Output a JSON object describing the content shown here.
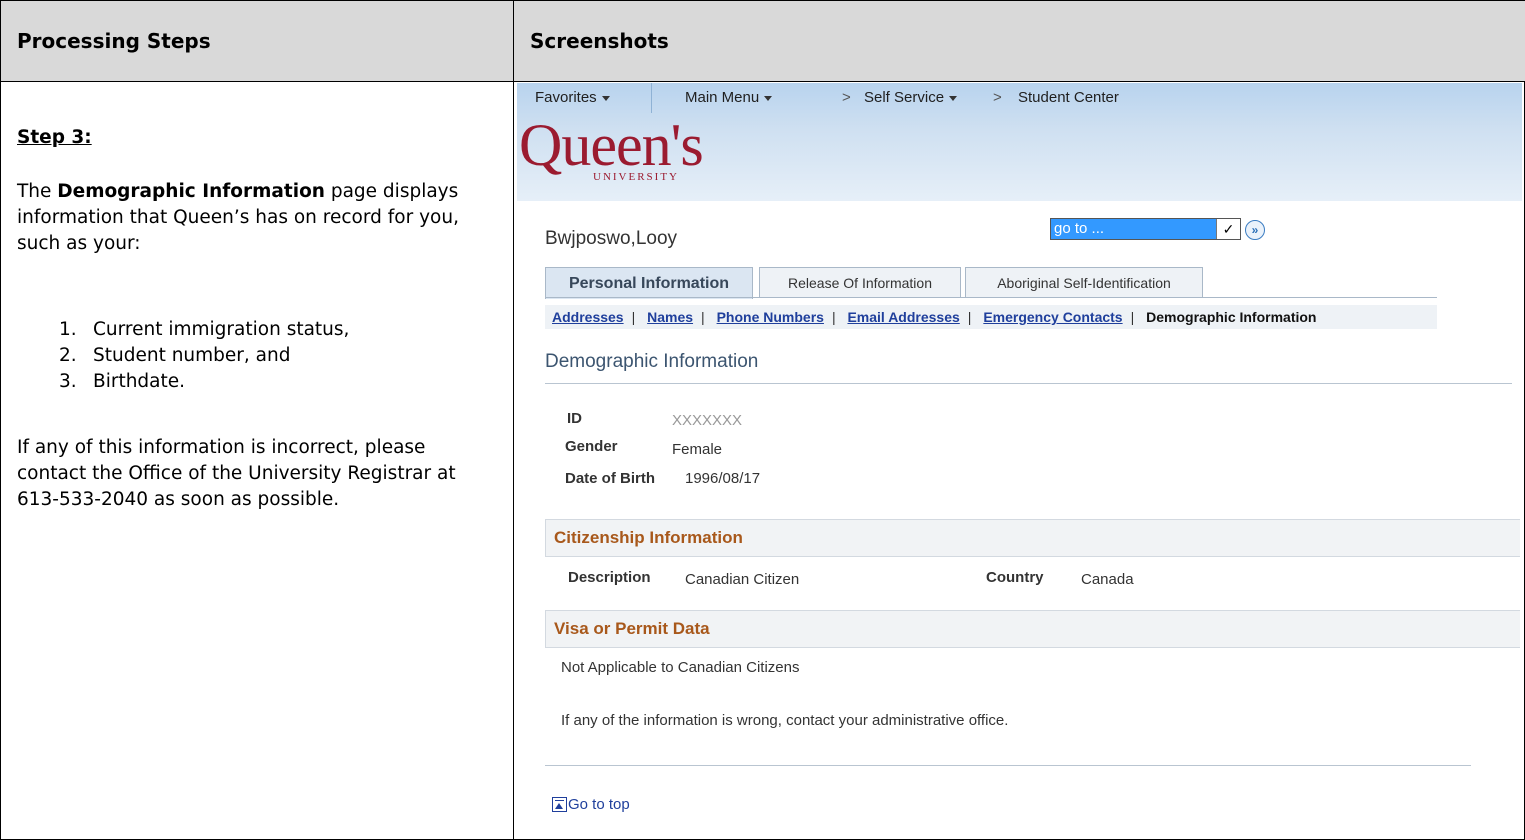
{
  "doc": {
    "col_left_header": "Processing Steps",
    "col_right_header": "Screenshots",
    "step_title": "Step 3:",
    "para1_pre": "The ",
    "para1_bold": "Demographic Information",
    "para1_post": " page displays information that Queen’s has on record for you, such as your:",
    "steps": [
      {
        "num": "1.",
        "text": "Current immigration status,"
      },
      {
        "num": "2.",
        "text": "Student number, and"
      },
      {
        "num": "3.",
        "text": "Birthdate."
      }
    ],
    "para2": "If any of this information is incorrect, please contact the Office of the University Registrar at 613-533-2040 as soon as possible."
  },
  "screenshot": {
    "menu": {
      "favorites": "Favorites",
      "main_menu": "Main Menu",
      "crumb_sep": ">",
      "self_service": "Self Service",
      "student_center": "Student Center"
    },
    "logo": {
      "main": "Queen's",
      "sub": "UNIVERSITY"
    },
    "username": "Bwjposwo,Looy",
    "goto": {
      "value": "go to ...",
      "dropdown_icon": "check-chevron-icon",
      "go_icon": "double-chevron-icon"
    },
    "tabs": [
      "Personal Information",
      "Release Of Information",
      "Aboriginal Self-Identification"
    ],
    "sublinks": [
      "Addresses",
      "Names",
      "Phone Numbers",
      "Email Addresses",
      "Emergency Contacts"
    ],
    "sublink_current": "Demographic Information",
    "page_heading": "Demographic Information",
    "fields": {
      "id_label": "ID",
      "id_value": "XXXXXXX",
      "gender_label": "Gender",
      "gender_value": "Female",
      "dob_label": "Date of Birth",
      "dob_value": "1996/08/17"
    },
    "citizenship": {
      "title": "Citizenship Information",
      "desc_label": "Description",
      "desc_value": "Canadian Citizen",
      "country_label": "Country",
      "country_value": "Canada"
    },
    "visa": {
      "title": "Visa or Permit Data",
      "note": "Not Applicable to Canadian Citizens"
    },
    "footer_note": "If any of the information is wrong, contact your administrative office.",
    "go_to_top": "Go to top"
  }
}
